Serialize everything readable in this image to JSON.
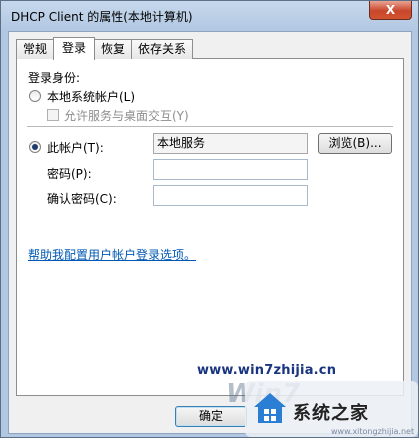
{
  "window": {
    "title": "DHCP Client 的属性(本地计算机)",
    "close_label": "X"
  },
  "tabs": [
    {
      "label": "常规",
      "active": false
    },
    {
      "label": "登录",
      "active": true
    },
    {
      "label": "恢复",
      "active": false
    },
    {
      "label": "依存关系",
      "active": false
    }
  ],
  "logon": {
    "section_label": "登录身份:",
    "local_system_label": "本地系统帐户(L)",
    "allow_desktop_label": "允许服务与桌面交互(Y)",
    "this_account_label": "此帐户(T):",
    "this_account_value": "本地服务",
    "browse_label": "浏览(B)...",
    "password_label": "密码(P):",
    "password_value": "",
    "confirm_label": "确认密码(C):",
    "confirm_value": "",
    "help_link": "帮助我配置用户帐户登录选项。"
  },
  "footer": {
    "ok_label": "确定"
  },
  "watermark": {
    "url": "www.win7zhijia.cn",
    "brand": "Win7",
    "site_name": "系统之家",
    "small_url": "www.xitongzhijia.net"
  },
  "colors": {
    "link": "#0058b4",
    "titlebar": "#b2c8e2",
    "close": "#c9462c"
  }
}
